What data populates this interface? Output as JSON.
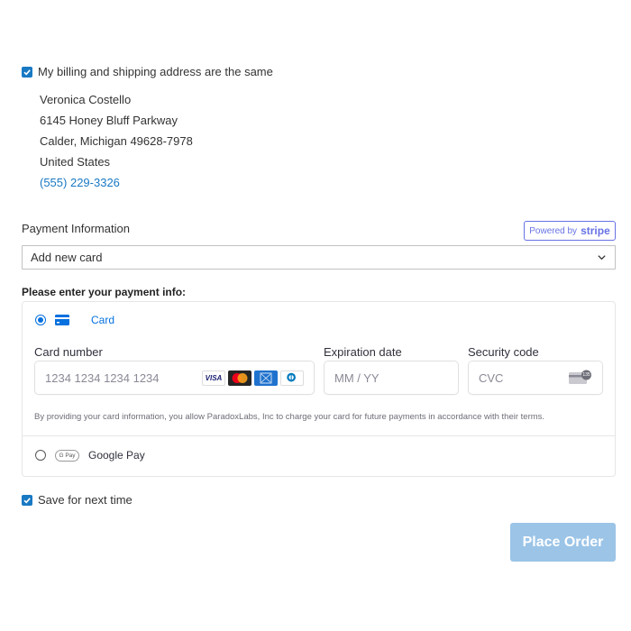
{
  "billing": {
    "same_address_label": "My billing and shipping address are the same",
    "same_address_checked": true,
    "address": {
      "name": "Veronica Costello",
      "street": "6145 Honey Bluff Parkway",
      "city_line": "Calder, Michigan 49628-7978",
      "country": "United States",
      "phone": "(555) 229-3326"
    }
  },
  "payment": {
    "title": "Payment Information",
    "stripe_badge": {
      "prefix": "Powered by",
      "brand": "stripe"
    },
    "card_select": {
      "value": "Add new card"
    },
    "enter_title": "Please enter your payment info:",
    "methods": {
      "card": {
        "label": "Card",
        "selected": true
      },
      "google_pay": {
        "label": "Google Pay",
        "logo_text": "G Pay",
        "selected": false
      }
    },
    "fields": {
      "card_number": {
        "label": "Card number",
        "placeholder": "1234 1234 1234 1234"
      },
      "expiration": {
        "label": "Expiration date",
        "placeholder": "MM / YY"
      },
      "cvc": {
        "label": "Security code",
        "placeholder": "CVC",
        "icon_text": "135"
      }
    },
    "card_brands": [
      "visa",
      "mastercard",
      "amex",
      "diners"
    ],
    "brand_text": {
      "visa": "VISA"
    },
    "terms": "By providing your card information, you allow ParadoxLabs, Inc to charge your card for future payments in accordance with their terms."
  },
  "save": {
    "label": "Save for next time",
    "checked": true
  },
  "actions": {
    "place_order": "Place Order"
  },
  "colors": {
    "accent": "#1979c3",
    "stripe": "#6772e5",
    "stripe_blue": "#0570de",
    "button": "#9bc4e7"
  }
}
